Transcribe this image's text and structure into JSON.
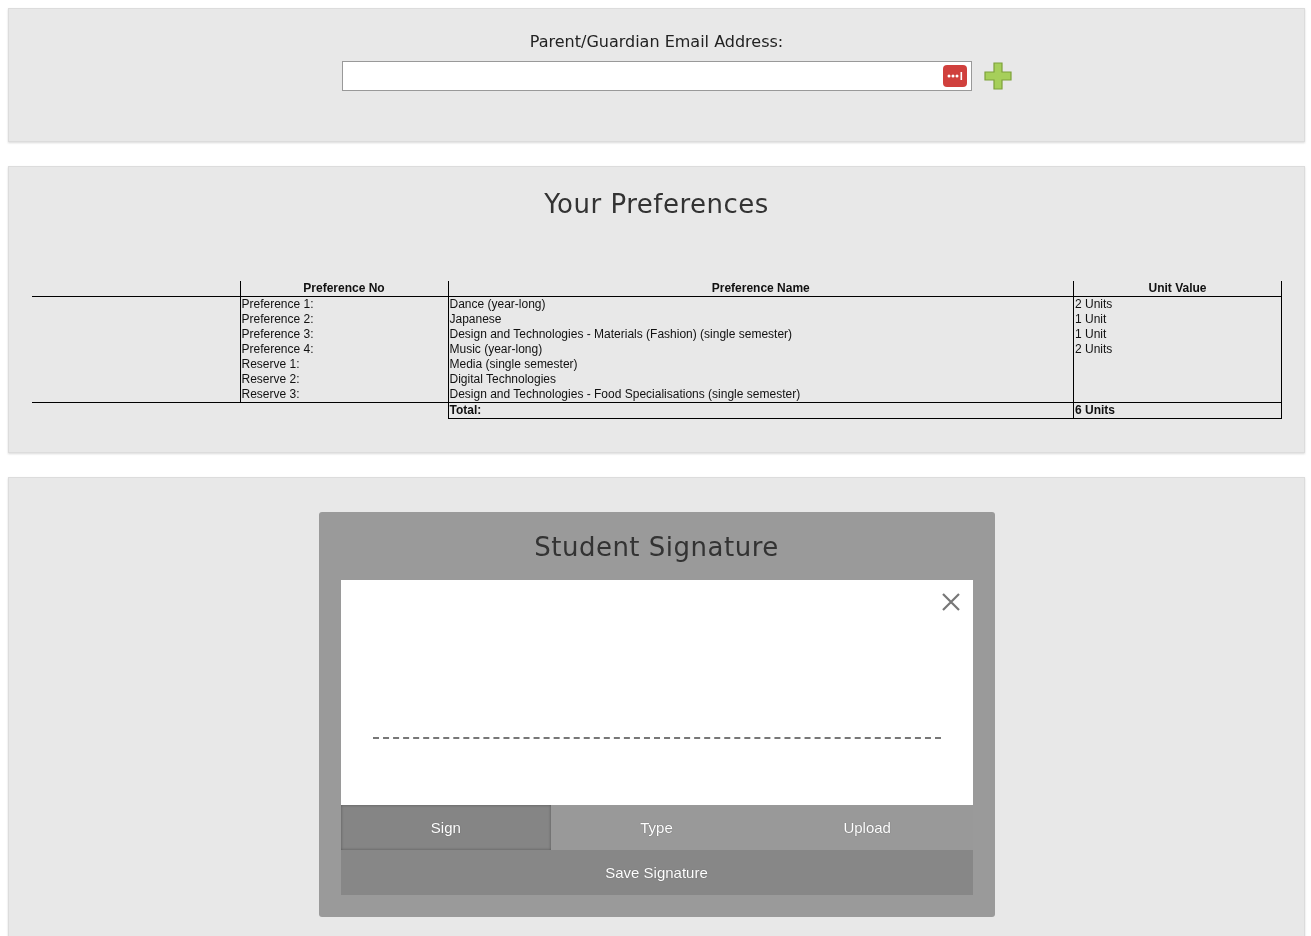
{
  "email": {
    "label": "Parent/Guardian Email Address:"
  },
  "preferences": {
    "title": "Your Preferences",
    "columns": [
      "Preference No",
      "Preference Name",
      "Unit Value"
    ],
    "rows": [
      {
        "no": "Preference 1:",
        "name": "Dance (year-long)",
        "units": "2 Units"
      },
      {
        "no": "Preference 2:",
        "name": "Japanese",
        "units": "1 Unit"
      },
      {
        "no": "Preference 3:",
        "name": "Design and Technologies - Materials (Fashion) (single semester)",
        "units": "1 Unit"
      },
      {
        "no": "Preference 4:",
        "name": "Music (year-long)",
        "units": "2 Units"
      },
      {
        "no": "Reserve 1:",
        "name": "Media (single semester)"
      },
      {
        "no": "Reserve 2:",
        "name": "Digital Technologies"
      },
      {
        "no": "Reserve 3:",
        "name": "Design and Technologies - Food Specialisations (single semester)"
      }
    ],
    "total_label": "Total:",
    "total_value": "6 Units"
  },
  "signature": {
    "title": "Student Signature",
    "tabs": [
      {
        "label": "Sign",
        "selected": true
      },
      {
        "label": "Type",
        "selected": false
      },
      {
        "label": "Upload",
        "selected": false
      }
    ],
    "save_button": "Save Signature"
  }
}
